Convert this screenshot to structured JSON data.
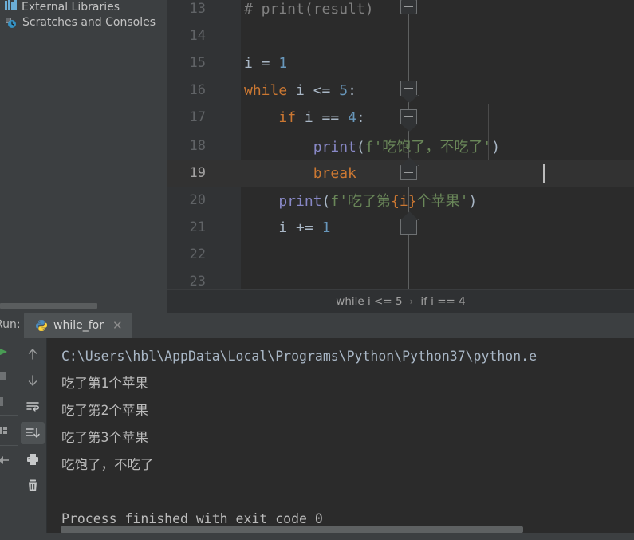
{
  "sidebar": {
    "items": [
      {
        "label": "External Libraries",
        "icon": "libraries-icon"
      },
      {
        "label": "Scratches and Consoles",
        "icon": "scratches-icon"
      }
    ]
  },
  "editor": {
    "lines": [
      {
        "number": "13",
        "segments": [
          {
            "text": "# print(result)",
            "cls": "comment"
          }
        ],
        "fold": "square-top",
        "indent": 0
      },
      {
        "number": "14",
        "segments": [],
        "fold": "none",
        "indent": 0
      },
      {
        "number": "15",
        "segments": [
          {
            "text": "i",
            "cls": "var"
          },
          {
            "text": " = ",
            "cls": "punct"
          },
          {
            "text": "1",
            "cls": "num"
          }
        ],
        "fold": "none",
        "indent": 0
      },
      {
        "number": "16",
        "segments": [
          {
            "text": "while",
            "cls": "kw"
          },
          {
            "text": " i ",
            "cls": "var"
          },
          {
            "text": "<=",
            "cls": "punct"
          },
          {
            "text": " ",
            "cls": "var"
          },
          {
            "text": "5",
            "cls": "num"
          },
          {
            "text": ":",
            "cls": "punct"
          }
        ],
        "fold": "point-down",
        "indent": 0
      },
      {
        "number": "17",
        "segments": [
          {
            "text": "    ",
            "cls": "var"
          },
          {
            "text": "if",
            "cls": "kw"
          },
          {
            "text": " i == ",
            "cls": "var"
          },
          {
            "text": "4",
            "cls": "num"
          },
          {
            "text": ":",
            "cls": "punct"
          }
        ],
        "fold": "point-down",
        "indent": 1
      },
      {
        "number": "18",
        "segments": [
          {
            "text": "        ",
            "cls": "var"
          },
          {
            "text": "print",
            "cls": "func"
          },
          {
            "text": "(",
            "cls": "punct"
          },
          {
            "text": "f'吃饱了，不吃了'",
            "cls": "str"
          },
          {
            "text": ")",
            "cls": "punct"
          }
        ],
        "fold": "none",
        "indent": 2
      },
      {
        "number": "19",
        "segments": [
          {
            "text": "        ",
            "cls": "var"
          },
          {
            "text": "break",
            "cls": "kw"
          }
        ],
        "fold": "point-up",
        "indent": 2,
        "current": true
      },
      {
        "number": "20",
        "segments": [
          {
            "text": "    ",
            "cls": "var"
          },
          {
            "text": "print",
            "cls": "func"
          },
          {
            "text": "(",
            "cls": "punct"
          },
          {
            "text": "f'吃了第",
            "cls": "str"
          },
          {
            "text": "{i}",
            "cls": "fstr-var"
          },
          {
            "text": "个苹果'",
            "cls": "str"
          },
          {
            "text": ")",
            "cls": "punct"
          }
        ],
        "fold": "none",
        "indent": 1
      },
      {
        "number": "21",
        "segments": [
          {
            "text": "    ",
            "cls": "var"
          },
          {
            "text": "i",
            "cls": "var"
          },
          {
            "text": " += ",
            "cls": "punct"
          },
          {
            "text": "1",
            "cls": "num"
          }
        ],
        "fold": "point-up",
        "indent": 1
      },
      {
        "number": "22",
        "segments": [],
        "fold": "none",
        "indent": 0
      },
      {
        "number": "23",
        "segments": [],
        "fold": "none",
        "indent": 0
      }
    ]
  },
  "breadcrumb": {
    "crumb1": "while i <= 5",
    "separator": "›",
    "crumb2": "if i == 4"
  },
  "run_panel": {
    "label": "Run:",
    "tab_title": "while_for",
    "tab_close": "✕",
    "toolbar_buttons": [
      {
        "name": "scroll-up-button",
        "icon": "arrow-up-icon"
      },
      {
        "name": "scroll-down-button",
        "icon": "arrow-down-icon"
      },
      {
        "name": "soft-wrap-button",
        "icon": "soft-wrap-icon"
      },
      {
        "name": "scroll-to-end-button",
        "icon": "scroll-to-end-icon",
        "active": true
      },
      {
        "name": "print-button",
        "icon": "printer-icon"
      },
      {
        "name": "clear-all-button",
        "icon": "trash-icon"
      }
    ],
    "side_buttons": [
      {
        "name": "rerun-button",
        "icon": "run-play-icon"
      },
      {
        "name": "stop-button",
        "icon": "stop-square-icon"
      },
      {
        "name": "pause-button",
        "icon": "pause-bar-icon"
      },
      {
        "name": "layout-button",
        "icon": "layout-icon"
      },
      {
        "name": "pin-button",
        "icon": "pin-icon"
      }
    ],
    "console": {
      "lines": [
        {
          "text": "C:\\Users\\hbl\\AppData\\Local\\Programs\\Python\\Python37\\python.e",
          "cls": "path"
        },
        {
          "text": "吃了第1个苹果",
          "cls": ""
        },
        {
          "text": "吃了第2个苹果",
          "cls": ""
        },
        {
          "text": "吃了第3个苹果",
          "cls": ""
        },
        {
          "text": "吃饱了，不吃了",
          "cls": ""
        },
        {
          "text": "",
          "cls": ""
        },
        {
          "text": "Process finished with exit code 0",
          "cls": "exit"
        }
      ]
    }
  },
  "colors": {
    "panel_bg": "#3c3f41",
    "editor_bg": "#2b2b2b",
    "gutter_bg": "#313335",
    "keyword": "#cc7832",
    "number": "#6897bb",
    "function": "#8888c6",
    "string": "#6a8759",
    "comment": "#808080",
    "text": "#a9b7c6",
    "accent_blue": "#6badd6",
    "run_green": "#499c54"
  }
}
